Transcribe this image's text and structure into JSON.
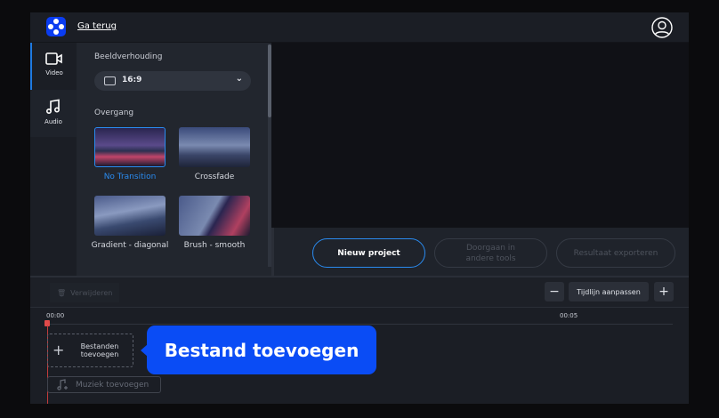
{
  "header": {
    "back_label": "Ga terug",
    "logo": "app-logo",
    "user_icon": "user-circle-icon"
  },
  "nav": [
    {
      "label": "Video",
      "icon": "video-camera-icon"
    },
    {
      "label": "Audio",
      "icon": "music-note-icon"
    }
  ],
  "panel": {
    "aspect_label": "Beeldverhouding",
    "aspect_value": "16:9",
    "transition_label": "Overgang",
    "transitions": [
      {
        "label": "No Transition",
        "selected": true
      },
      {
        "label": "Crossfade"
      },
      {
        "label": "Gradient - diagonal"
      },
      {
        "label": "Brush - smooth"
      }
    ]
  },
  "actions": {
    "new_project": "Nieuw project",
    "continue": "Doorgaan in andere tools",
    "export": "Resultaat exporteren"
  },
  "toolbar": {
    "delete": "Verwijderen",
    "zoom_out": "−",
    "fit": "Tijdlijn aanpassen",
    "zoom_in": "+"
  },
  "timeline": {
    "ticks": [
      "00:00",
      "00:05"
    ],
    "add_files": "Bestanden toevoegen",
    "add_files_plus": "+",
    "add_music": "Muziek toevoegen",
    "tooltip": "Bestand toevoegen"
  },
  "colors": {
    "accent": "#2a8bf0",
    "tooltip": "#0a4cf5",
    "playhead": "#e14a4a"
  }
}
